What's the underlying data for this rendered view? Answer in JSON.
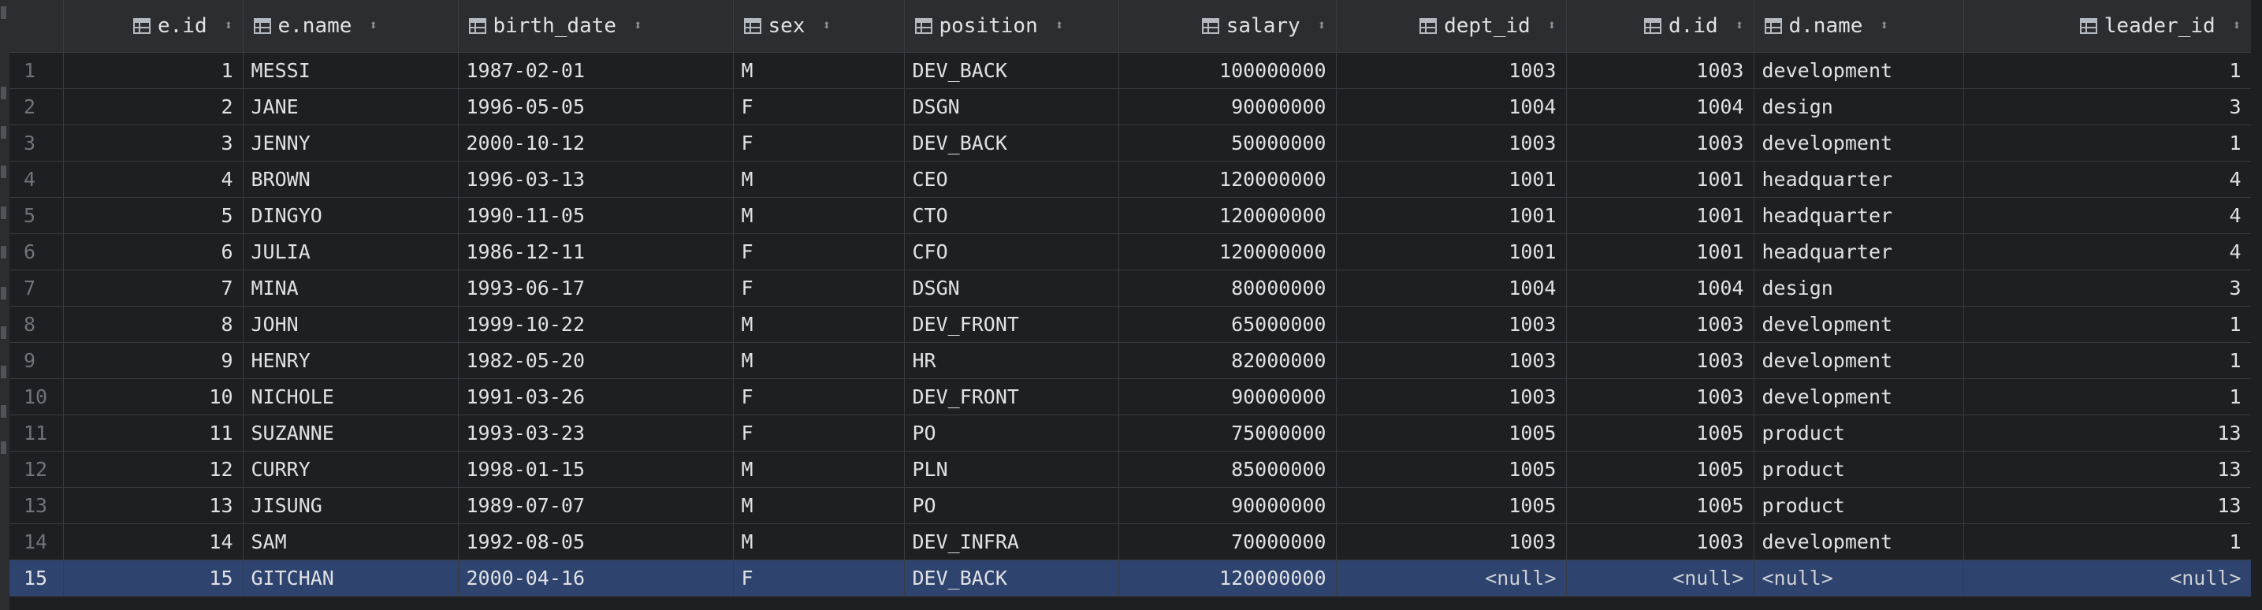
{
  "columns": [
    {
      "key": "eid",
      "label": "e.id",
      "align": "num"
    },
    {
      "key": "ename",
      "label": "e.name",
      "align": "text"
    },
    {
      "key": "birth",
      "label": "birth_date",
      "align": "text"
    },
    {
      "key": "sex",
      "label": "sex",
      "align": "text"
    },
    {
      "key": "position",
      "label": "position",
      "align": "text"
    },
    {
      "key": "salary",
      "label": "salary",
      "align": "num"
    },
    {
      "key": "dept_id",
      "label": "dept_id",
      "align": "num"
    },
    {
      "key": "did",
      "label": "d.id",
      "align": "num"
    },
    {
      "key": "dname",
      "label": "d.name",
      "align": "text"
    },
    {
      "key": "leader_id",
      "label": "leader_id",
      "align": "num"
    }
  ],
  "sort_glyph": "⬍",
  "rows": [
    {
      "n": "1",
      "eid": "1",
      "ename": "MESSI",
      "birth": "1987-02-01",
      "sex": "M",
      "position": "DEV_BACK",
      "salary": "100000000",
      "dept_id": "1003",
      "did": "1003",
      "dname": "development",
      "leader_id": "1"
    },
    {
      "n": "2",
      "eid": "2",
      "ename": "JANE",
      "birth": "1996-05-05",
      "sex": "F",
      "position": "DSGN",
      "salary": "90000000",
      "dept_id": "1004",
      "did": "1004",
      "dname": "design",
      "leader_id": "3"
    },
    {
      "n": "3",
      "eid": "3",
      "ename": "JENNY",
      "birth": "2000-10-12",
      "sex": "F",
      "position": "DEV_BACK",
      "salary": "50000000",
      "dept_id": "1003",
      "did": "1003",
      "dname": "development",
      "leader_id": "1"
    },
    {
      "n": "4",
      "eid": "4",
      "ename": "BROWN",
      "birth": "1996-03-13",
      "sex": "M",
      "position": "CEO",
      "salary": "120000000",
      "dept_id": "1001",
      "did": "1001",
      "dname": "headquarter",
      "leader_id": "4"
    },
    {
      "n": "5",
      "eid": "5",
      "ename": "DINGYO",
      "birth": "1990-11-05",
      "sex": "M",
      "position": "CTO",
      "salary": "120000000",
      "dept_id": "1001",
      "did": "1001",
      "dname": "headquarter",
      "leader_id": "4"
    },
    {
      "n": "6",
      "eid": "6",
      "ename": "JULIA",
      "birth": "1986-12-11",
      "sex": "F",
      "position": "CFO",
      "salary": "120000000",
      "dept_id": "1001",
      "did": "1001",
      "dname": "headquarter",
      "leader_id": "4"
    },
    {
      "n": "7",
      "eid": "7",
      "ename": "MINA",
      "birth": "1993-06-17",
      "sex": "F",
      "position": "DSGN",
      "salary": "80000000",
      "dept_id": "1004",
      "did": "1004",
      "dname": "design",
      "leader_id": "3"
    },
    {
      "n": "8",
      "eid": "8",
      "ename": "JOHN",
      "birth": "1999-10-22",
      "sex": "M",
      "position": "DEV_FRONT",
      "salary": "65000000",
      "dept_id": "1003",
      "did": "1003",
      "dname": "development",
      "leader_id": "1"
    },
    {
      "n": "9",
      "eid": "9",
      "ename": "HENRY",
      "birth": "1982-05-20",
      "sex": "M",
      "position": "HR",
      "salary": "82000000",
      "dept_id": "1003",
      "did": "1003",
      "dname": "development",
      "leader_id": "1"
    },
    {
      "n": "10",
      "eid": "10",
      "ename": "NICHOLE",
      "birth": "1991-03-26",
      "sex": "F",
      "position": "DEV_FRONT",
      "salary": "90000000",
      "dept_id": "1003",
      "did": "1003",
      "dname": "development",
      "leader_id": "1"
    },
    {
      "n": "11",
      "eid": "11",
      "ename": "SUZANNE",
      "birth": "1993-03-23",
      "sex": "F",
      "position": "PO",
      "salary": "75000000",
      "dept_id": "1005",
      "did": "1005",
      "dname": "product",
      "leader_id": "13"
    },
    {
      "n": "12",
      "eid": "12",
      "ename": "CURRY",
      "birth": "1998-01-15",
      "sex": "M",
      "position": "PLN",
      "salary": "85000000",
      "dept_id": "1005",
      "did": "1005",
      "dname": "product",
      "leader_id": "13"
    },
    {
      "n": "13",
      "eid": "13",
      "ename": "JISUNG",
      "birth": "1989-07-07",
      "sex": "M",
      "position": "PO",
      "salary": "90000000",
      "dept_id": "1005",
      "did": "1005",
      "dname": "product",
      "leader_id": "13"
    },
    {
      "n": "14",
      "eid": "14",
      "ename": "SAM",
      "birth": "1992-08-05",
      "sex": "M",
      "position": "DEV_INFRA",
      "salary": "70000000",
      "dept_id": "1003",
      "did": "1003",
      "dname": "development",
      "leader_id": "1"
    },
    {
      "n": "15",
      "eid": "15",
      "ename": "GITCHAN",
      "birth": "2000-04-16",
      "sex": "F",
      "position": "DEV_BACK",
      "salary": "120000000",
      "dept_id": "<null>",
      "did": "<null>",
      "dname": "<null>",
      "leader_id": "<null>",
      "selected": true
    }
  ],
  "colors": {
    "background": "#1e1f22",
    "header": "#2b2d30",
    "selected_row": "#2e436e",
    "grid_line": "#393b40"
  }
}
